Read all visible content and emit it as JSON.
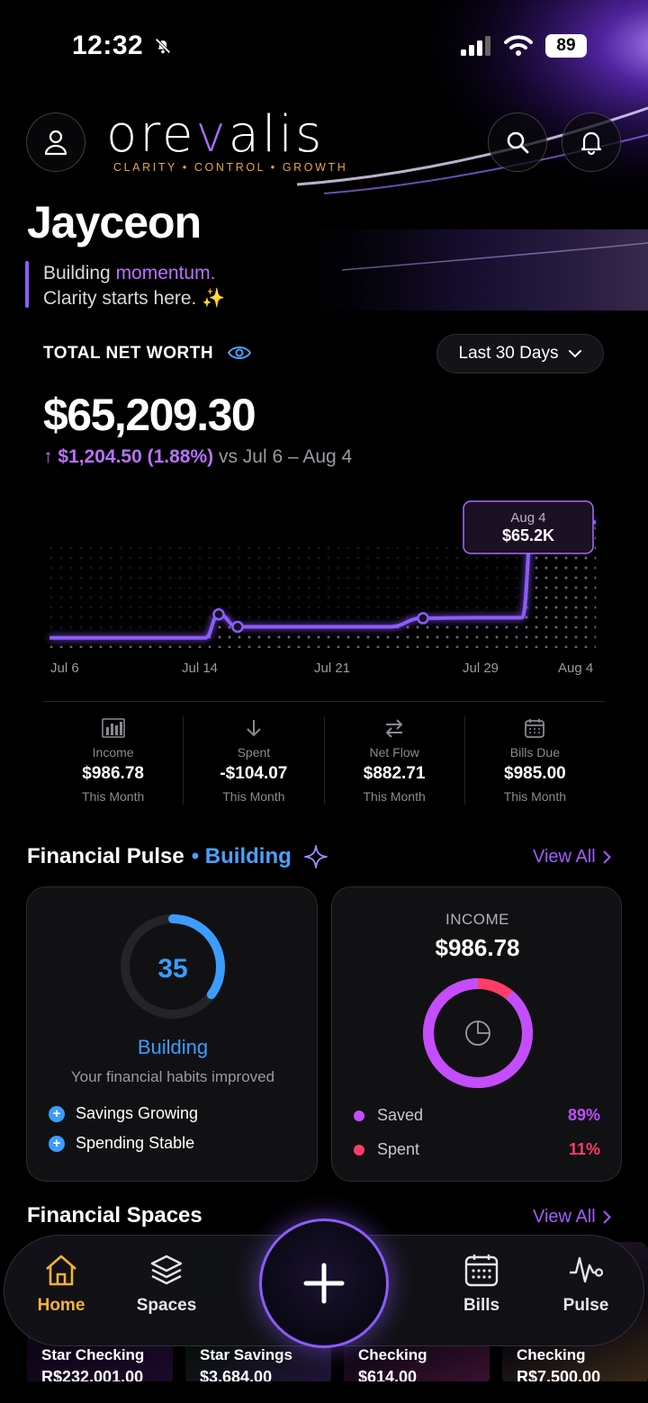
{
  "status_bar": {
    "time": "12:32",
    "battery": "89"
  },
  "brand": {
    "logo_part1": "ore",
    "logo_part2": "v",
    "logo_part3": "alis",
    "tagline": "CLARITY • CONTROL • GROWTH"
  },
  "greeting": {
    "name": "Jayceon",
    "line1_prefix": "Building ",
    "line1_highlight": "momentum.",
    "line2": "Clarity starts here. ✨"
  },
  "net_worth": {
    "label": "TOTAL NET WORTH",
    "range": "Last 30 Days",
    "amount": "$65,209.30",
    "change": "↑ $1,204.50 (1.88%)",
    "comparison": "vs Jul 6 – Aug 4"
  },
  "chart_data": {
    "type": "line",
    "x": [
      "Jul 6",
      "Jul 10",
      "Jul 12",
      "Jul 13",
      "Jul 14",
      "Jul 15",
      "Jul 20",
      "Jul 22",
      "Jul 24",
      "Jul 28",
      "Aug 1",
      "Aug 3",
      "Aug 4"
    ],
    "series": [
      {
        "values": [
          64005,
          64005,
          64005,
          64250,
          64120,
          64120,
          64120,
          64120,
          64210,
          64215,
          64215,
          65209,
          65209
        ]
      }
    ],
    "xticks": [
      "Jul 6",
      "Jul 14",
      "Jul 21",
      "Jul 29",
      "Aug 4"
    ],
    "tooltip": {
      "date": "Aug 4",
      "value": "$65.2K"
    },
    "grid": false,
    "accent": "#8c5cff"
  },
  "stats": [
    {
      "icon": "bar-chart-icon",
      "label": "Income",
      "value": "$986.78",
      "sub": "This Month"
    },
    {
      "icon": "arrow-down-icon",
      "label": "Spent",
      "value": "-$104.07",
      "sub": "This Month"
    },
    {
      "icon": "swap-icon",
      "label": "Net Flow",
      "value": "$882.71",
      "sub": "This Month"
    },
    {
      "icon": "calendar-icon",
      "label": "Bills Due",
      "value": "$985.00",
      "sub": "This Month"
    }
  ],
  "pulse": {
    "title": "Financial Pulse",
    "status": "• Building",
    "view_all": "View All",
    "score": {
      "value": "35",
      "fraction": 0.35,
      "label": "Building",
      "sub": "Your financial habits improved",
      "bullets": [
        "Savings Growing",
        "Spending Stable"
      ]
    },
    "income": {
      "label": "INCOME",
      "amount": "$986.78",
      "saved_label": "Saved",
      "saved_pct": "89%",
      "saved_fraction": 0.89,
      "spent_label": "Spent",
      "spent_pct": "11%",
      "saved_color": "#c34dff",
      "spent_color": "#ff3d67"
    }
  },
  "spaces": {
    "title": "Financial Spaces",
    "view_all": "View All",
    "tiles": [
      {
        "name": "Star Checking",
        "amount": "R$232,001.00"
      },
      {
        "name": "Star Savings",
        "amount": "$3,684.00"
      },
      {
        "name": "Checking",
        "amount": "$614.00"
      },
      {
        "name": "Checking",
        "amount": "R$7,500.00"
      }
    ]
  },
  "nav": {
    "home": "Home",
    "spaces": "Spaces",
    "bills": "Bills",
    "pulse": "Pulse"
  },
  "colors": {
    "accent_purple": "#8c5cff",
    "accent_blue": "#3c9dff",
    "home_active": "#f4b23a"
  }
}
